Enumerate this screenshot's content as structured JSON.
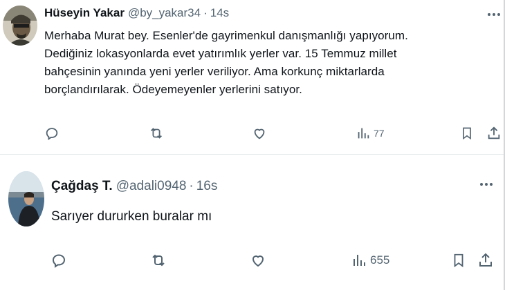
{
  "tweets": [
    {
      "name": "Hüseyin Yakar",
      "handle": "@by_yakar34",
      "separator": "·",
      "time": "14s",
      "text": "Merhaba Murat bey. Esenler'de gayrimenkul danışmanlığı yapıyorum.\nDediğiniz lokasyonlarda evet yatırımlık yerler var. 15 Temmuz millet\nbahçesinin yanında yeni yerler veriliyor. Ama korkunç miktarlarda\nborçlandırılarak. Ödeyemeyenler yerlerini satıyor.",
      "views": "77",
      "icons": [
        "reply-icon",
        "retweet-icon",
        "like-icon",
        "views-icon",
        "bookmark-icon",
        "share-icon"
      ]
    },
    {
      "name": "Çağdaş T.",
      "handle": "@adali0948",
      "separator": "·",
      "time": "16s",
      "text": "Sarıyer dururken buralar mı",
      "views": "655",
      "icons": [
        "reply-icon",
        "retweet-icon",
        "like-icon",
        "views-icon",
        "bookmark-icon",
        "share-icon"
      ]
    }
  ],
  "colors": {
    "text_primary": "#0f1419",
    "text_secondary": "#536471",
    "divider": "#e6e9eb"
  }
}
